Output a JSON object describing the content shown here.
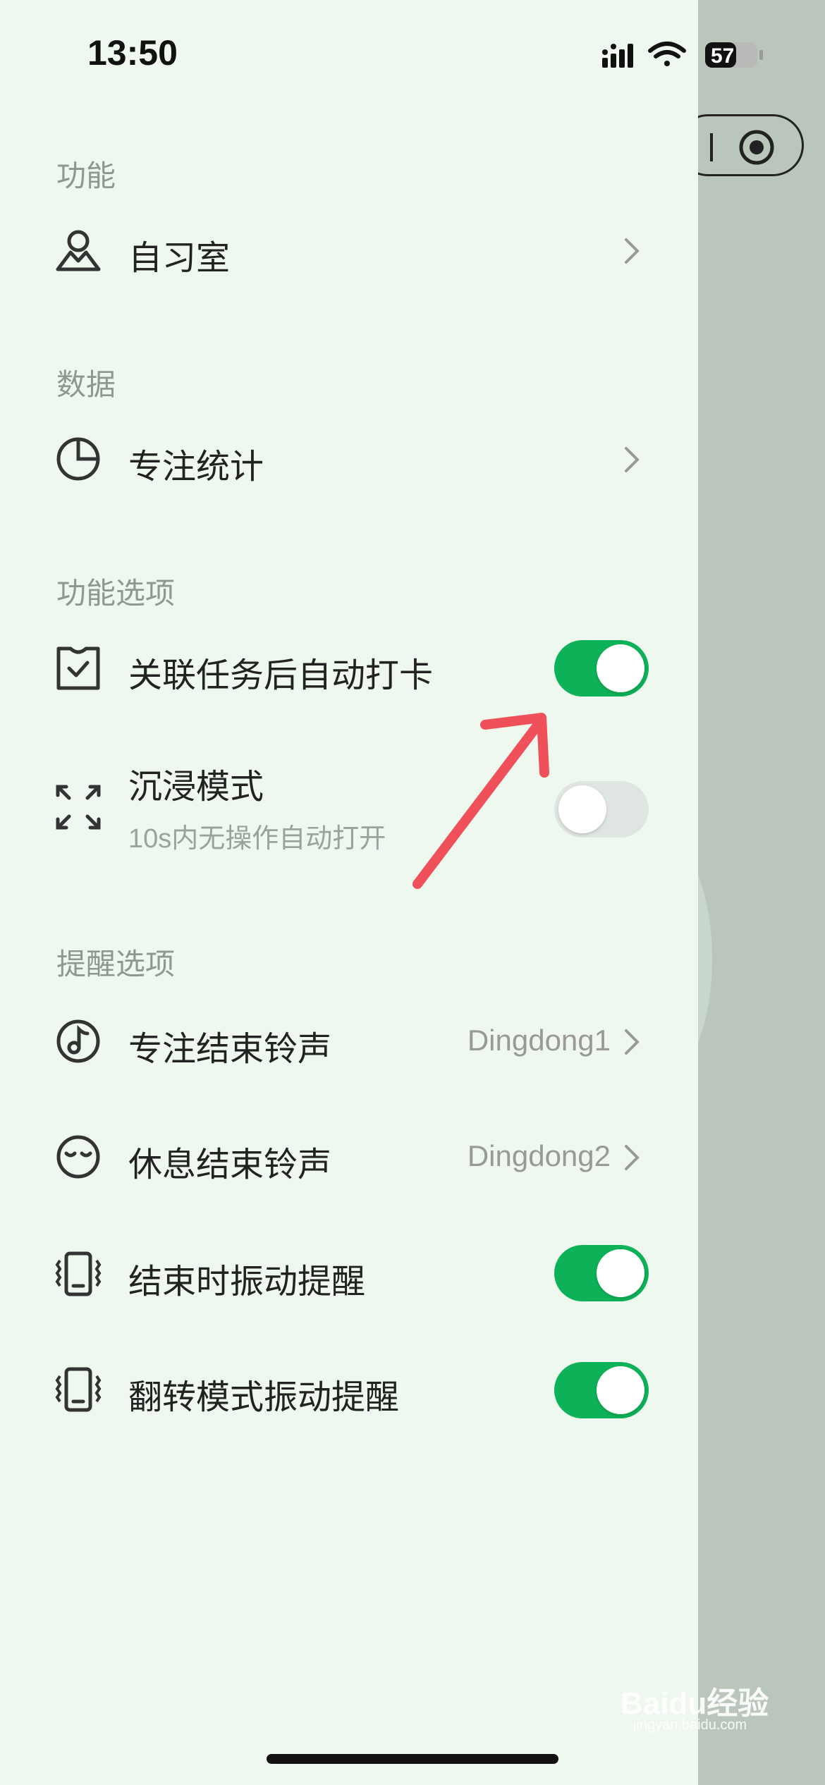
{
  "status_bar": {
    "time": "13:50",
    "battery": "57"
  },
  "sections": [
    {
      "title": "功能"
    },
    {
      "title": "数据"
    },
    {
      "title": "功能选项"
    },
    {
      "title": "提醒选项"
    }
  ],
  "rows": {
    "study_room": {
      "label": "自习室",
      "icon": "person-mountain-icon"
    },
    "focus_stats": {
      "label": "专注统计",
      "icon": "pie-chart-icon"
    },
    "auto_checkin": {
      "label": "关联任务后自动打卡",
      "icon": "calendar-check-icon",
      "toggle": true
    },
    "immersive": {
      "label": "沉浸模式",
      "subtitle": "10s内无操作自动打开",
      "icon": "expand-icon",
      "toggle": false
    },
    "focus_end_sound": {
      "label": "专注结束铃声",
      "value": "Dingdong1",
      "icon": "music-note-icon"
    },
    "rest_end_sound": {
      "label": "休息结束铃声",
      "value": "Dingdong2",
      "icon": "sleepy-face-icon"
    },
    "end_vibrate": {
      "label": "结束时振动提醒",
      "icon": "phone-vibrate-icon",
      "toggle": true
    },
    "flip_vibrate": {
      "label": "翻转模式振动提醒",
      "icon": "phone-vibrate-icon",
      "toggle": true
    }
  },
  "watermark": {
    "brand": "Baidu经验",
    "url": "jingyan.baidu.com"
  },
  "colors": {
    "toggle_on": "#0db158",
    "toggle_off": "#dfe5e0",
    "drawer_bg": "#eef8ef",
    "arrow": "#f0505a"
  }
}
